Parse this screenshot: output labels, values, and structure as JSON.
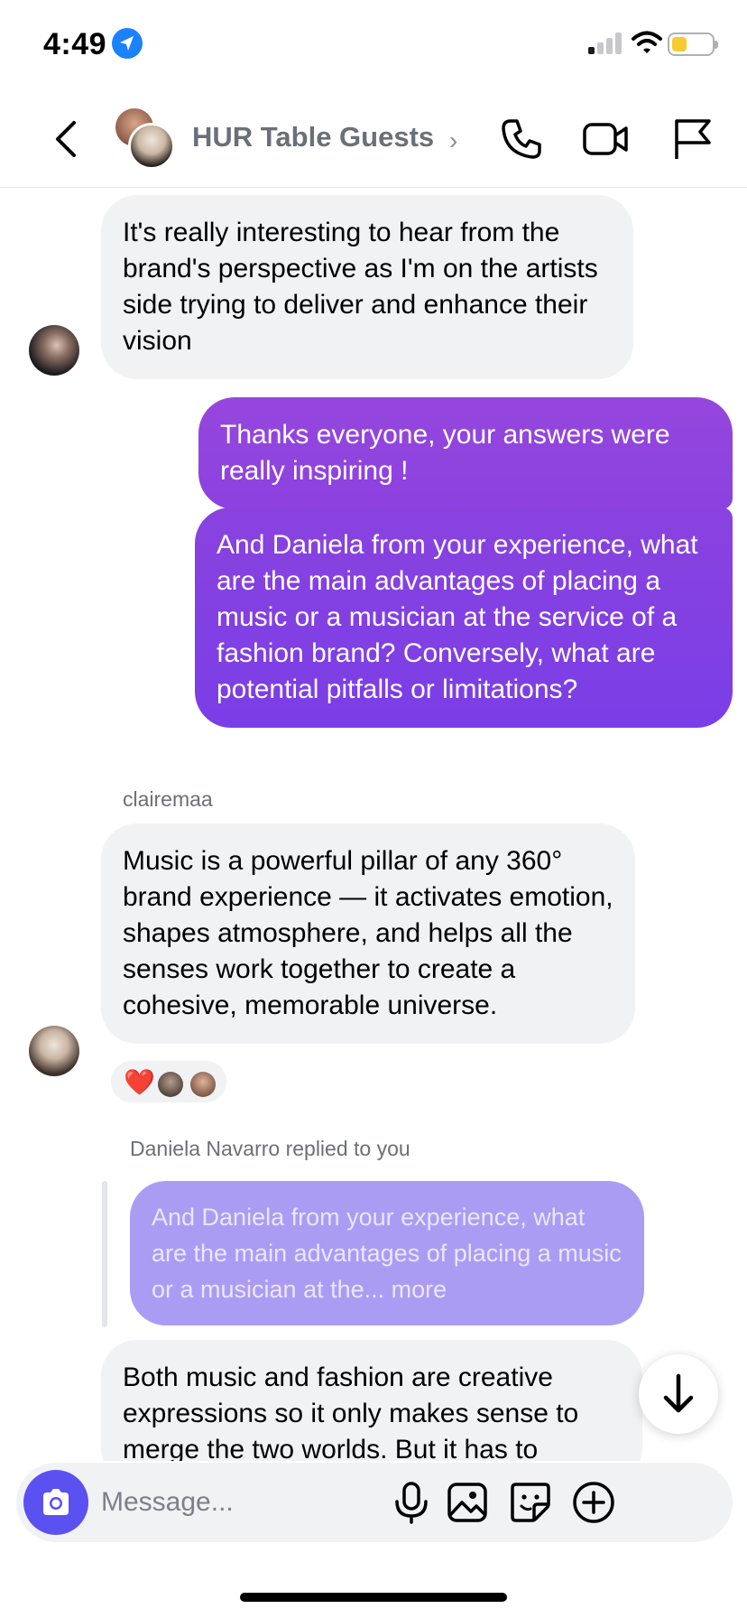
{
  "status_bar": {
    "time": "4:49",
    "icons": [
      "location-arrow-icon",
      "cellular-signal-icon",
      "wifi-icon",
      "battery-icon"
    ],
    "battery_color": "#f6cb2f"
  },
  "header": {
    "title": "HUR Table Guests",
    "chevron": "›",
    "icons": [
      "back-chevron-icon",
      "phone-icon",
      "video-camera-icon",
      "flag-icon"
    ]
  },
  "messages": [
    {
      "direction": "incoming",
      "text": "It's really interesting to hear from the brand's perspective as I'm on the artists side trying to deliver and enhance their vision"
    },
    {
      "direction": "outgoing",
      "text": "Thanks everyone, your answers were really inspiring !"
    },
    {
      "direction": "outgoing",
      "text": "And Daniela from your experience, what are the main advantages of placing a music or a musician at the service of a fashion brand? Conversely, what are potential pitfalls or limitations?"
    },
    {
      "direction": "incoming",
      "sender": "clairemaa",
      "text": "Music is a powerful pillar of any 360° brand experience — it activates emotion, shapes atmosphere, and helps all the senses work together to create a cohesive, memorable universe.",
      "reactions": [
        "❤️"
      ]
    },
    {
      "direction": "incoming",
      "reply_label": "Daniela Navarro replied to you",
      "quoted_text": "And Daniela from your experience, what are the main advantages of placing a music or a musician at the... more",
      "text": "Both music and fashion are creative expressions so it only makes sense to merge the two worlds. But it has to"
    }
  ],
  "composer": {
    "placeholder": "Message...",
    "icons": [
      "camera-icon",
      "microphone-icon",
      "gallery-icon",
      "sticker-icon",
      "add-icon"
    ]
  },
  "colors": {
    "outgoing_gradient_top": "#9547dd",
    "outgoing_gradient_bottom": "#7a3ee6",
    "incoming_bubble": "#f1f2f4",
    "reply_bubble": "#ab9cf3",
    "camera_button": "#5b51f0"
  }
}
